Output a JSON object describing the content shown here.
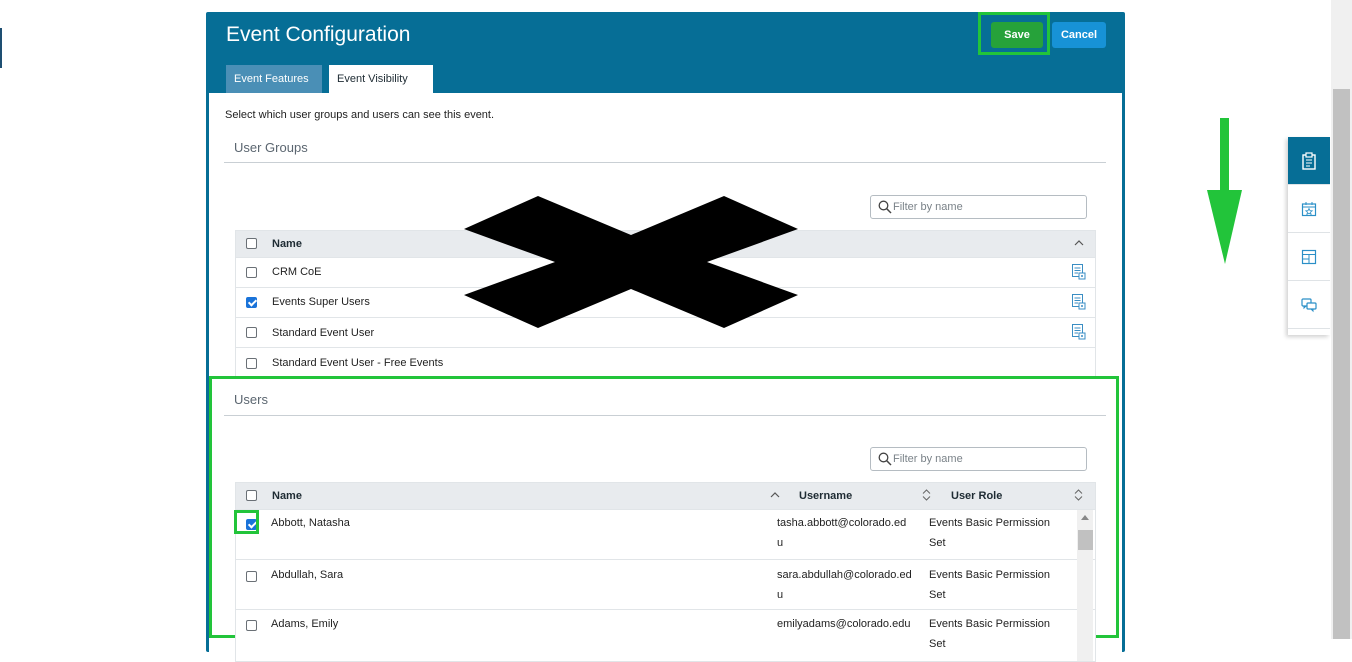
{
  "modal": {
    "title": "Event Configuration",
    "save_label": "Save",
    "cancel_label": "Cancel",
    "tabs": [
      {
        "label": "Event Features",
        "active": false
      },
      {
        "label": "Event Visibility",
        "active": true
      }
    ]
  },
  "visibility": {
    "intro": "Select which user groups and users can see this event."
  },
  "user_groups": {
    "title": "User Groups",
    "filter_placeholder": "Filter by name",
    "header_name": "Name",
    "rows": [
      {
        "name": "CRM CoE",
        "checked": false,
        "has_icon": true
      },
      {
        "name": "Events Super Users",
        "checked": true,
        "has_icon": true
      },
      {
        "name": "Standard Event User",
        "checked": false,
        "has_icon": true
      },
      {
        "name": "Standard Event User - Free Events",
        "checked": false,
        "has_icon": false
      }
    ]
  },
  "users": {
    "title": "Users",
    "filter_placeholder": "Filter by name",
    "header_name": "Name",
    "header_username": "Username",
    "header_role": "User Role",
    "rows": [
      {
        "name": "Abbott, Natasha",
        "username_line1": "tasha.abbott@colorado.ed",
        "username_line2": "u",
        "role_line1": "Events Basic Permission",
        "role_line2": "Set",
        "checked": true
      },
      {
        "name": "Abdullah, Sara",
        "username_line1": "sara.abdullah@colorado.ed",
        "username_line2": "u",
        "role_line1": "Events Basic Permission",
        "role_line2": "Set",
        "checked": false
      },
      {
        "name": "Adams, Emily",
        "username_line1": "emilyadams@colorado.edu",
        "username_line2": "",
        "role_line1": "Events Basic Permission",
        "role_line2": "Set",
        "checked": false
      }
    ]
  },
  "colors": {
    "header_blue": "#066e96",
    "save_green": "#26a23a",
    "cancel_blue": "#1792d6",
    "highlight_green": "#22c43a",
    "checkbox_blue": "#1a73d9"
  },
  "side_panel": {
    "icons": [
      "clipboard-icon",
      "calendar-star-icon",
      "layout-icon",
      "chat-bubbles-icon"
    ]
  }
}
